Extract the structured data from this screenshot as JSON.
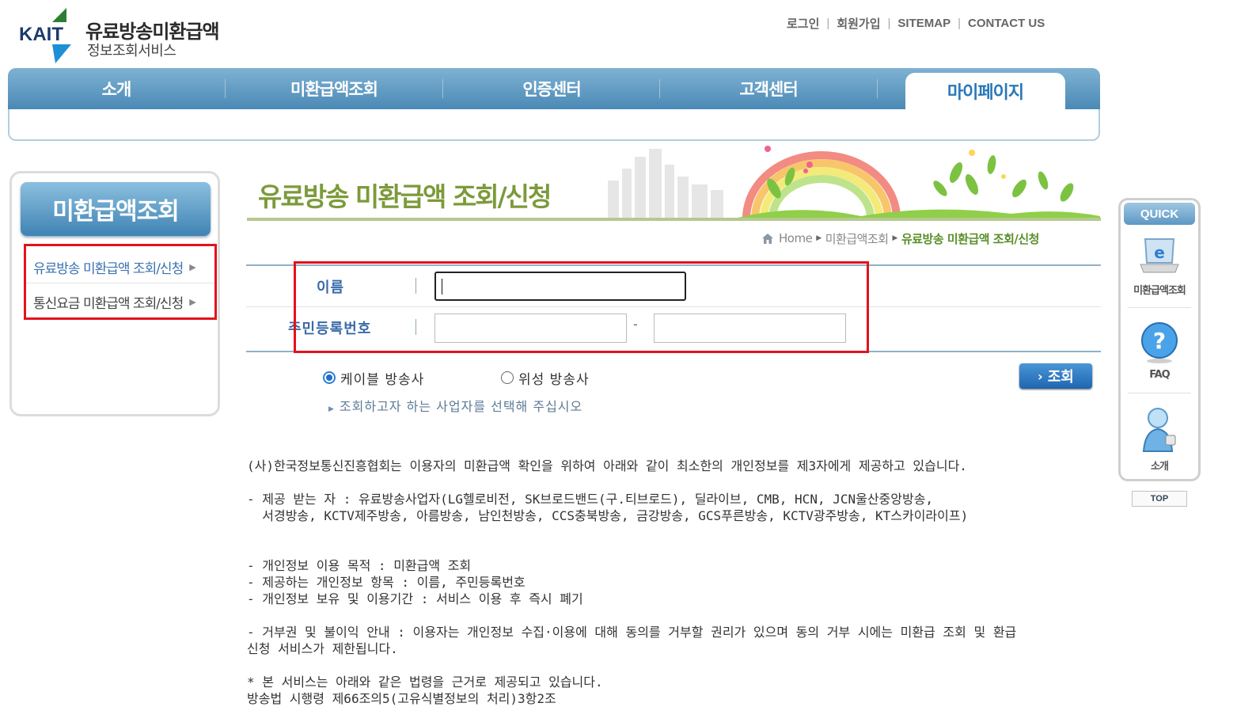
{
  "logo": {
    "mark": "KAIT",
    "title": "유료방송미환급액",
    "subtitle": "정보조회서비스"
  },
  "util_nav": [
    "로그인",
    "회원가입",
    "SITEMAP",
    "CONTACT US"
  ],
  "gnb": {
    "items": [
      "소개",
      "미환급액조회",
      "인증센터",
      "고객센터"
    ],
    "active": "마이페이지"
  },
  "lnb": {
    "title": "미환급액조회",
    "items": [
      {
        "label": "유료방송 미환급액 조회/신청",
        "active": true
      },
      {
        "label": "통신요금 미환급액 조회/신청",
        "active": false
      }
    ]
  },
  "page": {
    "title": "유료방송 미환급액 조회/신청",
    "breadcrumb": {
      "home": "Home",
      "level1": "미환급액조회",
      "current": "유료방송 미환급액 조회/신청"
    }
  },
  "form": {
    "name_label": "이름",
    "name_value": "",
    "ssn_label": "주민등록번호",
    "ssn_front": "",
    "ssn_back": "",
    "ssn_dash": "-",
    "radio_cable": "케이블 방송사",
    "radio_satellite": "위성 방송사",
    "selected": "케이블 방송사",
    "hint": "조회하고자 하는 사업자를 선택해 주십시오",
    "search_button": "조회"
  },
  "notice": {
    "intro": "(사)한국정보통신진흥협회는 이용자의 미환급액 확인을 위하여 아래와 같이 최소한의 개인정보를 제3자에게 제공하고 있습니다.",
    "recipients_1": "- 제공 받는 자 : 유료방송사업자(LG헬로비전, SK브로드밴드(구.티브로드), 딜라이브, CMB, HCN, JCN울산중앙방송,",
    "recipients_2": "  서경방송, KCTV제주방송, 아름방송, 남인천방송, CCS충북방송, 금강방송, GCS푸른방송, KCTV광주방송, KT스카이라이프)",
    "purpose": "- 개인정보 이용 목적 : 미환급액 조회",
    "items": "- 제공하는 개인정보 항목 : 이름, 주민등록번호",
    "retention": "- 개인정보 보유 및 이용기간 : 서비스 이용 후 즉시 폐기",
    "refusal_1": "- 거부권 및 불이익 안내 : 이용자는 개인정보 수집·이용에 대해 동의를 거부할 권리가 있으며 동의 거부 시에는 미환급 조회 및 환급",
    "refusal_2": "신청 서비스가 제한됩니다.",
    "law_1": "* 본 서비스는 아래와 같은 법령을 근거로 제공되고 있습니다.",
    "law_2": "방송법 시행령 제66조의5(고유식별정보의 처리)3항2조"
  },
  "quick": {
    "head": "QUICK",
    "items": [
      "미환급액조회",
      "FAQ",
      "소개"
    ],
    "top": "TOP"
  },
  "colors": {
    "accent_blue": "#4a89b5",
    "title_green": "#7c9a3a",
    "highlight_red": "#e4121c"
  },
  "icons": [
    "home-icon",
    "laptop-e-icon",
    "faq-question-icon",
    "person-icon"
  ]
}
